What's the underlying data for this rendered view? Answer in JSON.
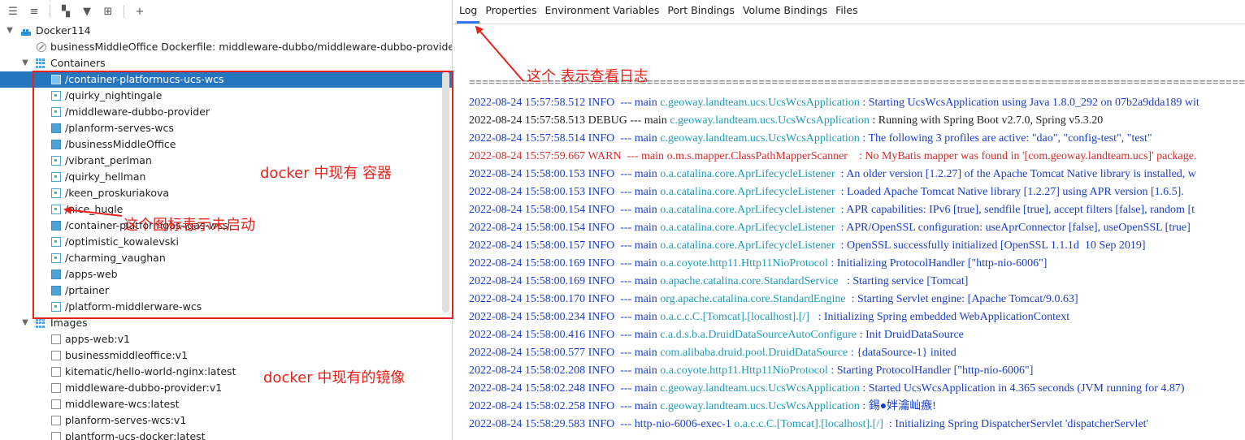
{
  "toolbar": {
    "buttons": [
      {
        "name": "expand-all-icon",
        "glyph": "☰"
      },
      {
        "name": "collapse-all-icon",
        "glyph": "≡"
      },
      {
        "name": "group-by-icon",
        "glyph": "▚"
      },
      {
        "name": "filter-icon",
        "glyph": "▼"
      },
      {
        "name": "new-container-icon",
        "glyph": "⊞"
      },
      {
        "name": "add-icon",
        "glyph": "+"
      }
    ]
  },
  "tree": {
    "root": {
      "label": "Docker114",
      "icon": "docker-icon"
    },
    "dockerfile": {
      "label": "businessMiddleOffice Dockerfile: middleware-dubbo/middleware-dubbo-provider/D"
    },
    "containers": {
      "label": "Containers",
      "items": [
        {
          "label": "/container-platformucs-ucs-wcs",
          "state": "running",
          "selected": true
        },
        {
          "label": "/quirky_nightingale",
          "state": "stopped"
        },
        {
          "label": "/middleware-dubbo-provider",
          "state": "stopped"
        },
        {
          "label": "/planform-serves-wcs",
          "state": "running"
        },
        {
          "label": "/businessMiddleOffice",
          "state": "running"
        },
        {
          "label": "/vibrant_perlman",
          "state": "stopped"
        },
        {
          "label": "/quirky_hellman",
          "state": "stopped"
        },
        {
          "label": "/keen_proskuriakova",
          "state": "stopped"
        },
        {
          "label": "/nice_hugle",
          "state": "stopped"
        },
        {
          "label": "/container-platformgas-igas-wcs",
          "state": "running"
        },
        {
          "label": "/optimistic_kowalevski",
          "state": "stopped"
        },
        {
          "label": "/charming_vaughan",
          "state": "stopped"
        },
        {
          "label": "/apps-web",
          "state": "running"
        },
        {
          "label": "/prtainer",
          "state": "running"
        },
        {
          "label": "/platform-middlerware-wcs",
          "state": "stopped"
        }
      ]
    },
    "images": {
      "label": "Images",
      "items": [
        {
          "label": "apps-web:v1"
        },
        {
          "label": "businessmiddleoffice:v1"
        },
        {
          "label": "kitematic/hello-world-nginx:latest"
        },
        {
          "label": "middleware-dubbo-provider:v1"
        },
        {
          "label": "middleware-wcs:latest"
        },
        {
          "label": "planform-serves-wcs:v1"
        },
        {
          "label": "plantform-ucs-docker:latest"
        }
      ]
    }
  },
  "tabs": [
    {
      "label": "Log",
      "active": true
    },
    {
      "label": "Properties"
    },
    {
      "label": "Environment Variables"
    },
    {
      "label": "Port Bindings"
    },
    {
      "label": "Volume Bindings"
    },
    {
      "label": "Files"
    }
  ],
  "log": {
    "separator": "=====================================================================================================================================================================",
    "colors": {
      "info": "#1a3ec8",
      "debug": "#1f1f1f",
      "warn": "#d22e2e",
      "logger": "#1f9bb8"
    },
    "lines": [
      {
        "ts": "2022-08-24 15:57:58.512 INFO  --- main ",
        "logger": "c.geoway.landteam.ucs.UcsWcsApplication",
        "msg": " : Starting UcsWcsApplication using Java 1.8.0_292 on 07b2a9dda189 wit",
        "level": "info"
      },
      {
        "ts": "2022-08-24 15:57:58.513 DEBUG --- main ",
        "logger": "c.geoway.landteam.ucs.UcsWcsApplication",
        "msg": " : Running with Spring Boot v2.7.0, Spring v5.3.20",
        "level": "debug"
      },
      {
        "ts": "2022-08-24 15:57:58.514 INFO  --- main ",
        "logger": "c.geoway.landteam.ucs.UcsWcsApplication",
        "msg": " : The following 3 profiles are active: \"dao\", \"config-test\", \"test\"",
        "level": "info"
      },
      {
        "ts": "2022-08-24 15:57:59.667 WARN  --- main ",
        "logger": "o.m.s.mapper.ClassPathMapperScanner",
        "msg": "    : No MyBatis mapper was found in '[com.geoway.landteam.ucs]' package.",
        "level": "warn"
      },
      {
        "ts": "2022-08-24 15:58:00.153 INFO  --- main ",
        "logger": "o.a.catalina.core.AprLifecycleListener",
        "msg": "  : An older version [1.2.27] of the Apache Tomcat Native library is installed, w",
        "level": "info"
      },
      {
        "ts": "2022-08-24 15:58:00.153 INFO  --- main ",
        "logger": "o.a.catalina.core.AprLifecycleListener",
        "msg": "  : Loaded Apache Tomcat Native library [1.2.27] using APR version [1.6.5].",
        "level": "info"
      },
      {
        "ts": "2022-08-24 15:58:00.154 INFO  --- main ",
        "logger": "o.a.catalina.core.AprLifecycleListener",
        "msg": "  : APR capabilities: IPv6 [true], sendfile [true], accept filters [false], random [t",
        "level": "info"
      },
      {
        "ts": "2022-08-24 15:58:00.154 INFO  --- main ",
        "logger": "o.a.catalina.core.AprLifecycleListener",
        "msg": "  : APR/OpenSSL configuration: useAprConnector [false], useOpenSSL [true]",
        "level": "info"
      },
      {
        "ts": "2022-08-24 15:58:00.157 INFO  --- main ",
        "logger": "o.a.catalina.core.AprLifecycleListener",
        "msg": "  : OpenSSL successfully initialized [OpenSSL 1.1.1d  10 Sep 2019]",
        "level": "info"
      },
      {
        "ts": "2022-08-24 15:58:00.169 INFO  --- main ",
        "logger": "o.a.coyote.http11.Http11NioProtocol",
        "msg": " : Initializing ProtocolHandler [\"http-nio-6006\"]",
        "level": "info"
      },
      {
        "ts": "2022-08-24 15:58:00.169 INFO  --- main ",
        "logger": "o.apache.catalina.core.StandardService",
        "msg": "   : Starting service [Tomcat]",
        "level": "info"
      },
      {
        "ts": "2022-08-24 15:58:00.170 INFO  --- main ",
        "logger": "org.apache.catalina.core.StandardEngine",
        "msg": "  : Starting Servlet engine: [Apache Tomcat/9.0.63]",
        "level": "info"
      },
      {
        "ts": "2022-08-24 15:58:00.234 INFO  --- main ",
        "logger": "o.a.c.c.C.[Tomcat].[localhost].[/]",
        "msg": "   : Initializing Spring embedded WebApplicationContext",
        "level": "info"
      },
      {
        "ts": "2022-08-24 15:58:00.416 INFO  --- main ",
        "logger": "c.a.d.s.b.a.DruidDataSourceAutoConfigure",
        "msg": " : Init DruidDataSource",
        "level": "info"
      },
      {
        "ts": "2022-08-24 15:58:00.577 INFO  --- main ",
        "logger": "com.alibaba.druid.pool.DruidDataSource",
        "msg": " : {dataSource-1} inited",
        "level": "info"
      },
      {
        "ts": "2022-08-24 15:58:02.208 INFO  --- main ",
        "logger": "o.a.coyote.http11.Http11NioProtocol",
        "msg": " : Starting ProtocolHandler [\"http-nio-6006\"]",
        "level": "info"
      },
      {
        "ts": "2022-08-24 15:58:02.248 INFO  --- main ",
        "logger": "c.geoway.landteam.ucs.UcsWcsApplication",
        "msg": " : Started UcsWcsApplication in 4.365 seconds (JVM running for 4.87)",
        "level": "info"
      },
      {
        "ts": "2022-08-24 15:58:02.258 INFO  --- main ",
        "logger": "c.geoway.landteam.ucs.UcsWcsApplication",
        "msg": " : 錫●姅瀹屾瘯!",
        "level": "info"
      },
      {
        "ts": "2022-08-24 15:58:29.583 INFO  --- http-nio-6006-exec-1 ",
        "logger": "o.a.c.c.C.[Tomcat].[localhost].[/]",
        "msg": "  : Initializing Spring DispatcherServlet 'dispatcherServlet'",
        "level": "info"
      }
    ]
  },
  "annotations": {
    "log_tab_note": "这个 表示查看日志",
    "containers_note": "docker 中现有 容器",
    "not_started_note": "这个图标表示未启动",
    "images_note": "docker 中现有的镜像",
    "color": "#e8221b"
  }
}
